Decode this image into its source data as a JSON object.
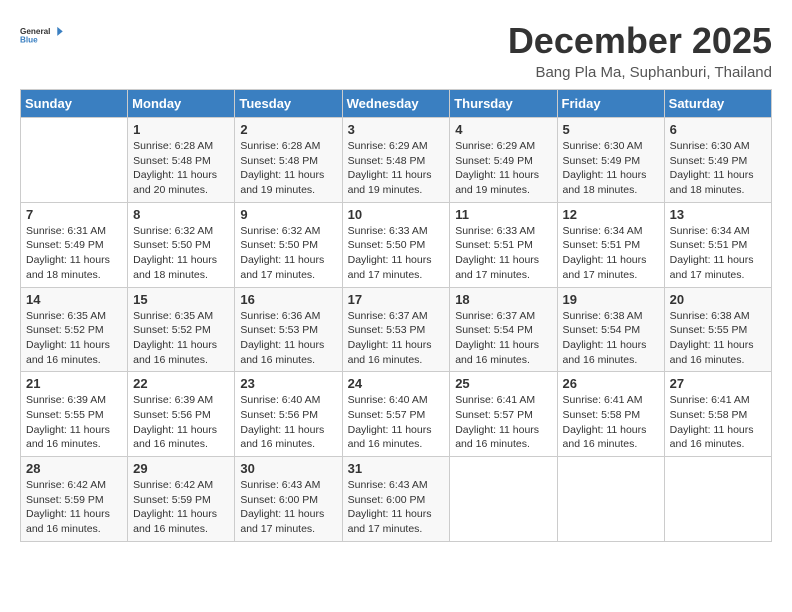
{
  "logo": {
    "line1": "General",
    "line2": "Blue"
  },
  "title": "December 2025",
  "location": "Bang Pla Ma, Suphanburi, Thailand",
  "weekdays": [
    "Sunday",
    "Monday",
    "Tuesday",
    "Wednesday",
    "Thursday",
    "Friday",
    "Saturday"
  ],
  "weeks": [
    [
      {
        "day": "",
        "sunrise": "",
        "sunset": "",
        "daylight": ""
      },
      {
        "day": "1",
        "sunrise": "Sunrise: 6:28 AM",
        "sunset": "Sunset: 5:48 PM",
        "daylight": "Daylight: 11 hours and 20 minutes."
      },
      {
        "day": "2",
        "sunrise": "Sunrise: 6:28 AM",
        "sunset": "Sunset: 5:48 PM",
        "daylight": "Daylight: 11 hours and 19 minutes."
      },
      {
        "day": "3",
        "sunrise": "Sunrise: 6:29 AM",
        "sunset": "Sunset: 5:48 PM",
        "daylight": "Daylight: 11 hours and 19 minutes."
      },
      {
        "day": "4",
        "sunrise": "Sunrise: 6:29 AM",
        "sunset": "Sunset: 5:49 PM",
        "daylight": "Daylight: 11 hours and 19 minutes."
      },
      {
        "day": "5",
        "sunrise": "Sunrise: 6:30 AM",
        "sunset": "Sunset: 5:49 PM",
        "daylight": "Daylight: 11 hours and 18 minutes."
      },
      {
        "day": "6",
        "sunrise": "Sunrise: 6:30 AM",
        "sunset": "Sunset: 5:49 PM",
        "daylight": "Daylight: 11 hours and 18 minutes."
      }
    ],
    [
      {
        "day": "7",
        "sunrise": "Sunrise: 6:31 AM",
        "sunset": "Sunset: 5:49 PM",
        "daylight": "Daylight: 11 hours and 18 minutes."
      },
      {
        "day": "8",
        "sunrise": "Sunrise: 6:32 AM",
        "sunset": "Sunset: 5:50 PM",
        "daylight": "Daylight: 11 hours and 18 minutes."
      },
      {
        "day": "9",
        "sunrise": "Sunrise: 6:32 AM",
        "sunset": "Sunset: 5:50 PM",
        "daylight": "Daylight: 11 hours and 17 minutes."
      },
      {
        "day": "10",
        "sunrise": "Sunrise: 6:33 AM",
        "sunset": "Sunset: 5:50 PM",
        "daylight": "Daylight: 11 hours and 17 minutes."
      },
      {
        "day": "11",
        "sunrise": "Sunrise: 6:33 AM",
        "sunset": "Sunset: 5:51 PM",
        "daylight": "Daylight: 11 hours and 17 minutes."
      },
      {
        "day": "12",
        "sunrise": "Sunrise: 6:34 AM",
        "sunset": "Sunset: 5:51 PM",
        "daylight": "Daylight: 11 hours and 17 minutes."
      },
      {
        "day": "13",
        "sunrise": "Sunrise: 6:34 AM",
        "sunset": "Sunset: 5:51 PM",
        "daylight": "Daylight: 11 hours and 17 minutes."
      }
    ],
    [
      {
        "day": "14",
        "sunrise": "Sunrise: 6:35 AM",
        "sunset": "Sunset: 5:52 PM",
        "daylight": "Daylight: 11 hours and 16 minutes."
      },
      {
        "day": "15",
        "sunrise": "Sunrise: 6:35 AM",
        "sunset": "Sunset: 5:52 PM",
        "daylight": "Daylight: 11 hours and 16 minutes."
      },
      {
        "day": "16",
        "sunrise": "Sunrise: 6:36 AM",
        "sunset": "Sunset: 5:53 PM",
        "daylight": "Daylight: 11 hours and 16 minutes."
      },
      {
        "day": "17",
        "sunrise": "Sunrise: 6:37 AM",
        "sunset": "Sunset: 5:53 PM",
        "daylight": "Daylight: 11 hours and 16 minutes."
      },
      {
        "day": "18",
        "sunrise": "Sunrise: 6:37 AM",
        "sunset": "Sunset: 5:54 PM",
        "daylight": "Daylight: 11 hours and 16 minutes."
      },
      {
        "day": "19",
        "sunrise": "Sunrise: 6:38 AM",
        "sunset": "Sunset: 5:54 PM",
        "daylight": "Daylight: 11 hours and 16 minutes."
      },
      {
        "day": "20",
        "sunrise": "Sunrise: 6:38 AM",
        "sunset": "Sunset: 5:55 PM",
        "daylight": "Daylight: 11 hours and 16 minutes."
      }
    ],
    [
      {
        "day": "21",
        "sunrise": "Sunrise: 6:39 AM",
        "sunset": "Sunset: 5:55 PM",
        "daylight": "Daylight: 11 hours and 16 minutes."
      },
      {
        "day": "22",
        "sunrise": "Sunrise: 6:39 AM",
        "sunset": "Sunset: 5:56 PM",
        "daylight": "Daylight: 11 hours and 16 minutes."
      },
      {
        "day": "23",
        "sunrise": "Sunrise: 6:40 AM",
        "sunset": "Sunset: 5:56 PM",
        "daylight": "Daylight: 11 hours and 16 minutes."
      },
      {
        "day": "24",
        "sunrise": "Sunrise: 6:40 AM",
        "sunset": "Sunset: 5:57 PM",
        "daylight": "Daylight: 11 hours and 16 minutes."
      },
      {
        "day": "25",
        "sunrise": "Sunrise: 6:41 AM",
        "sunset": "Sunset: 5:57 PM",
        "daylight": "Daylight: 11 hours and 16 minutes."
      },
      {
        "day": "26",
        "sunrise": "Sunrise: 6:41 AM",
        "sunset": "Sunset: 5:58 PM",
        "daylight": "Daylight: 11 hours and 16 minutes."
      },
      {
        "day": "27",
        "sunrise": "Sunrise: 6:41 AM",
        "sunset": "Sunset: 5:58 PM",
        "daylight": "Daylight: 11 hours and 16 minutes."
      }
    ],
    [
      {
        "day": "28",
        "sunrise": "Sunrise: 6:42 AM",
        "sunset": "Sunset: 5:59 PM",
        "daylight": "Daylight: 11 hours and 16 minutes."
      },
      {
        "day": "29",
        "sunrise": "Sunrise: 6:42 AM",
        "sunset": "Sunset: 5:59 PM",
        "daylight": "Daylight: 11 hours and 16 minutes."
      },
      {
        "day": "30",
        "sunrise": "Sunrise: 6:43 AM",
        "sunset": "Sunset: 6:00 PM",
        "daylight": "Daylight: 11 hours and 17 minutes."
      },
      {
        "day": "31",
        "sunrise": "Sunrise: 6:43 AM",
        "sunset": "Sunset: 6:00 PM",
        "daylight": "Daylight: 11 hours and 17 minutes."
      },
      {
        "day": "",
        "sunrise": "",
        "sunset": "",
        "daylight": ""
      },
      {
        "day": "",
        "sunrise": "",
        "sunset": "",
        "daylight": ""
      },
      {
        "day": "",
        "sunrise": "",
        "sunset": "",
        "daylight": ""
      }
    ]
  ]
}
